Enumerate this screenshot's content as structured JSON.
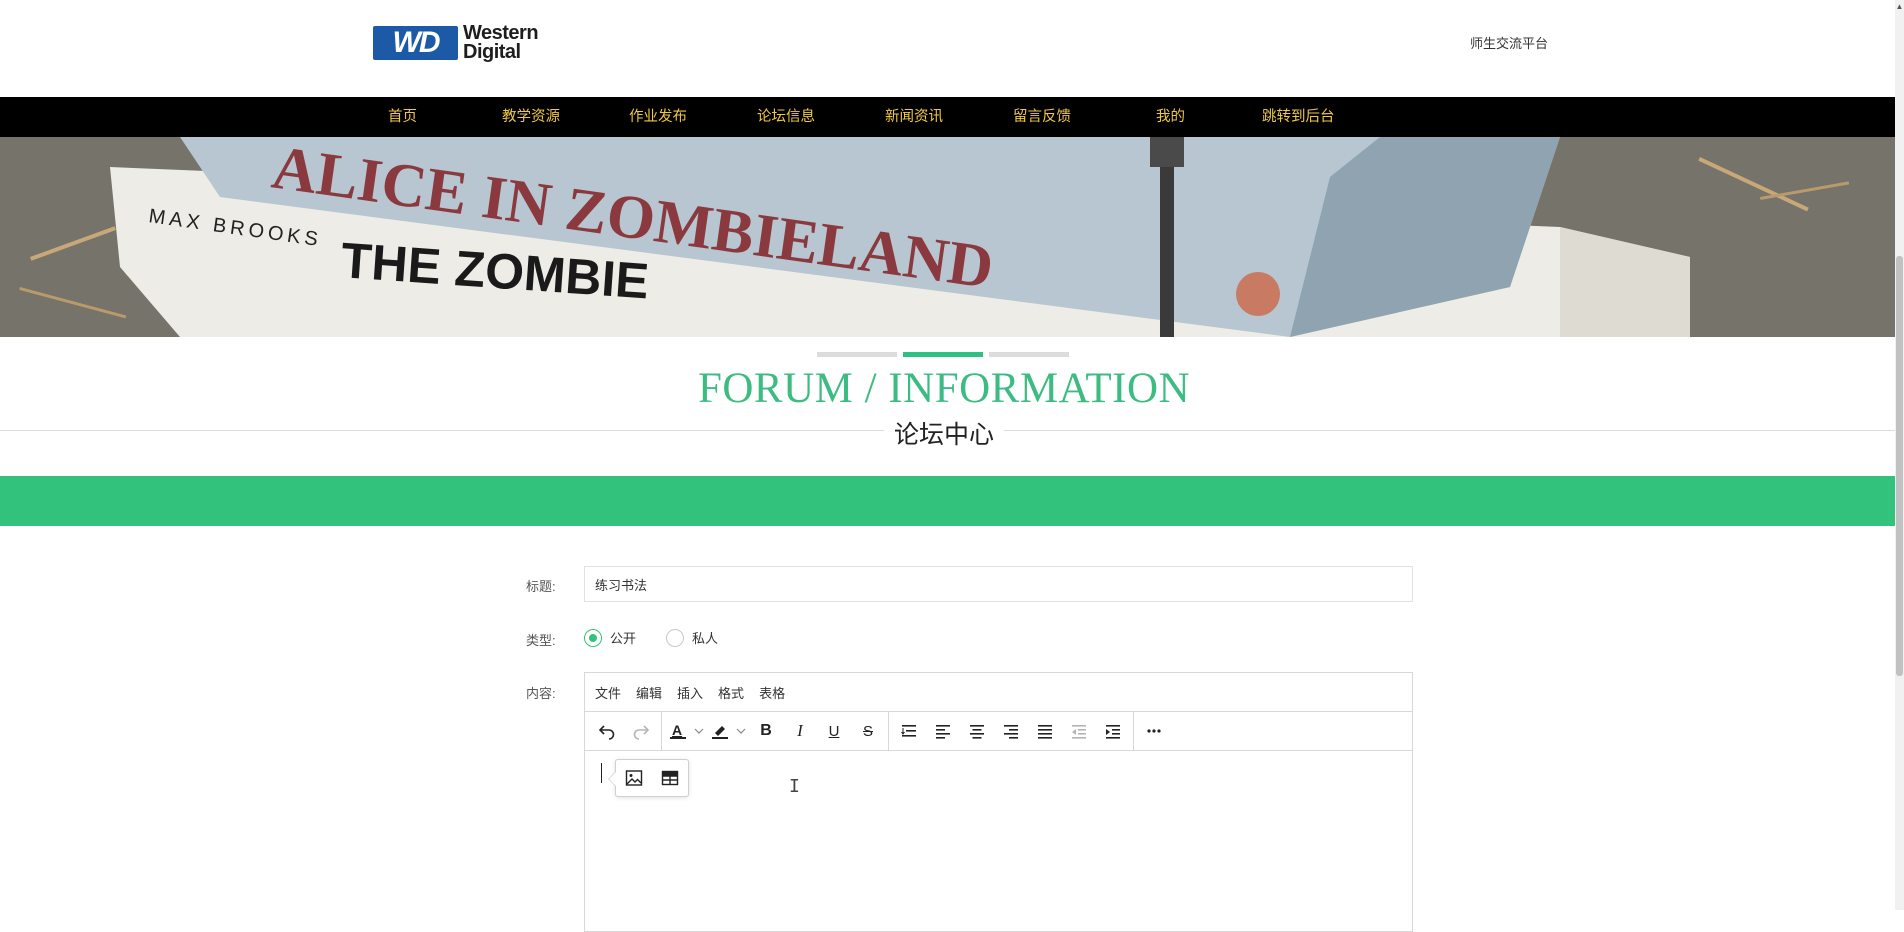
{
  "header": {
    "logo_mark": "WD",
    "logo_line1": "Western",
    "logo_line2": "Digital",
    "platform_title": "师生交流平台"
  },
  "nav": {
    "items": [
      "首页",
      "教学资源",
      "作业发布",
      "论坛信息",
      "新闻资讯",
      "留言反馈",
      "我的",
      "跳转到后台"
    ]
  },
  "banner": {
    "carousel": {
      "slides": 3,
      "active": 2
    }
  },
  "section": {
    "title_en": "FORUM / INFORMATION",
    "title_cn": "论坛中心"
  },
  "form": {
    "title_label": "标题:",
    "title_value": "练习书法",
    "type_label": "类型:",
    "type_options": [
      "公开",
      "私人"
    ],
    "type_selected": "公开",
    "content_label": "内容:"
  },
  "editor": {
    "menu": [
      "文件",
      "编辑",
      "插入",
      "格式",
      "表格"
    ],
    "toolbar_icons": [
      "undo-icon",
      "redo-icon",
      "text-color-icon",
      "highlight-icon",
      "bold-icon",
      "italic-icon",
      "underline-icon",
      "strikethrough-icon",
      "line-height-icon",
      "align-left-icon",
      "align-center-icon",
      "align-right-icon",
      "align-justify-icon",
      "outdent-icon",
      "indent-icon",
      "more-icon"
    ],
    "quick_insert": [
      "image-icon",
      "table-icon"
    ]
  },
  "colors": {
    "accent": "#33c27b",
    "nav_bg": "#000000",
    "nav_text": "#f0c848",
    "title_en": "#3cbc82"
  }
}
